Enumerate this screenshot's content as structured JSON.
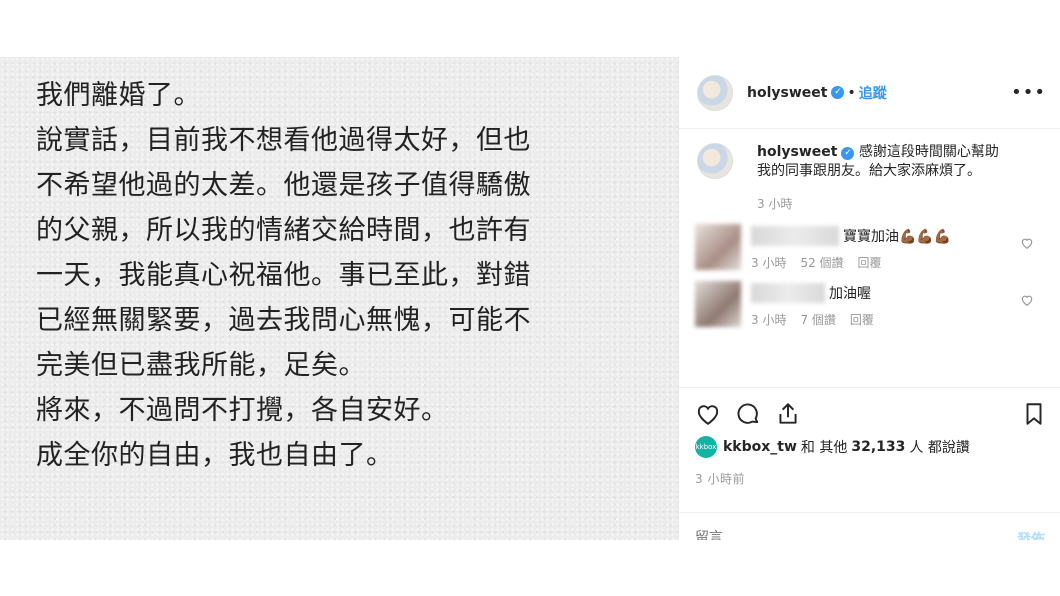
{
  "photo": {
    "lines": [
      "我們離婚了。",
      "說實話，目前我不想看他過得太好，但也",
      "不希望他過的太差。他還是孩子值得驕傲",
      "的父親，所以我的情緒交給時間，也許有",
      "一天，我能真心祝福他。事已至此，對錯",
      "已經無關緊要，過去我問心無愧，可能不",
      "完美但已盡我所能，足矣。",
      "將來，不過問不打攪，各自安好。",
      "成全你的自由，我也自由了。"
    ]
  },
  "header": {
    "username": "holysweet",
    "dot": "•",
    "follow_label": "追蹤",
    "more_label": "•••"
  },
  "caption": {
    "username": "holysweet",
    "line1": "感謝這段時間關心幫助",
    "line2": "我的同事跟朋友。給大家添麻煩了。",
    "time": "3 小時"
  },
  "comments": [
    {
      "text": "寶寶加油💪🏾💪🏾💪🏾",
      "time": "3 小時",
      "likes": "52 個讚",
      "reply": "回覆"
    },
    {
      "text": "加油喔",
      "time": "3 小時",
      "likes": "7 個讚",
      "reply": "回覆"
    }
  ],
  "likes": {
    "badge": "kkbox",
    "user": "kkbox_tw",
    "and_others": "和 其他",
    "count": "32,133",
    "suffix": "人 都說讚"
  },
  "timeago": "3 小時前",
  "add_comment": {
    "placeholder": "留言……",
    "post_label": "發佈"
  },
  "colors": {
    "accent": "#3897f0",
    "text": "#262626",
    "muted": "#999999"
  }
}
